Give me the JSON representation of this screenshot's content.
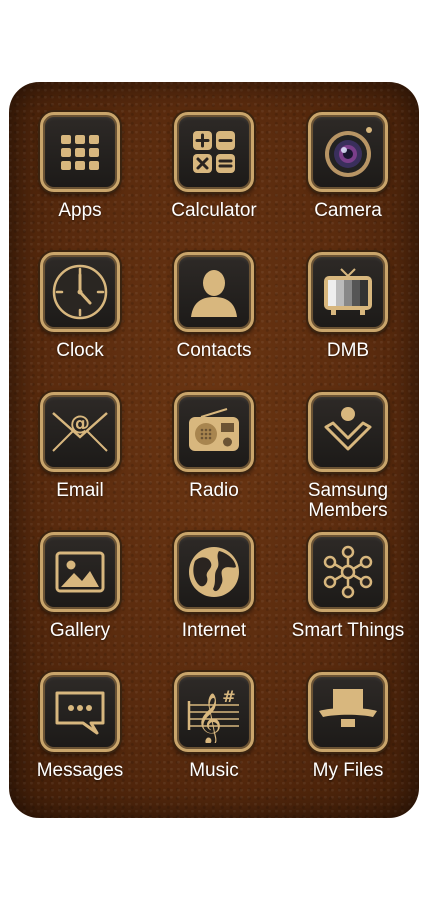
{
  "apps": [
    {
      "label": "Apps",
      "icon": "apps-grid-icon"
    },
    {
      "label": "Calculator",
      "icon": "calculator-icon"
    },
    {
      "label": "Camera",
      "icon": "camera-lens-icon"
    },
    {
      "label": "Clock",
      "icon": "clock-icon"
    },
    {
      "label": "Contacts",
      "icon": "person-silhouette-icon"
    },
    {
      "label": "DMB",
      "icon": "tv-icon"
    },
    {
      "label": "Email",
      "icon": "envelope-at-icon"
    },
    {
      "label": "Radio",
      "icon": "radio-icon"
    },
    {
      "label": "Samsung Members",
      "icon": "samsung-members-icon"
    },
    {
      "label": "Gallery",
      "icon": "picture-icon"
    },
    {
      "label": "Internet",
      "icon": "globe-icon"
    },
    {
      "label": "Smart Things",
      "icon": "smartthings-hub-icon"
    },
    {
      "label": "Messages",
      "icon": "chat-bubble-icon"
    },
    {
      "label": "Music",
      "icon": "treble-clef-icon"
    },
    {
      "label": "My Files",
      "icon": "folder-icon"
    }
  ],
  "colors": {
    "gold": "#c9a56b",
    "leather": "#5a2b0e",
    "tile": "#1f1c1a"
  }
}
